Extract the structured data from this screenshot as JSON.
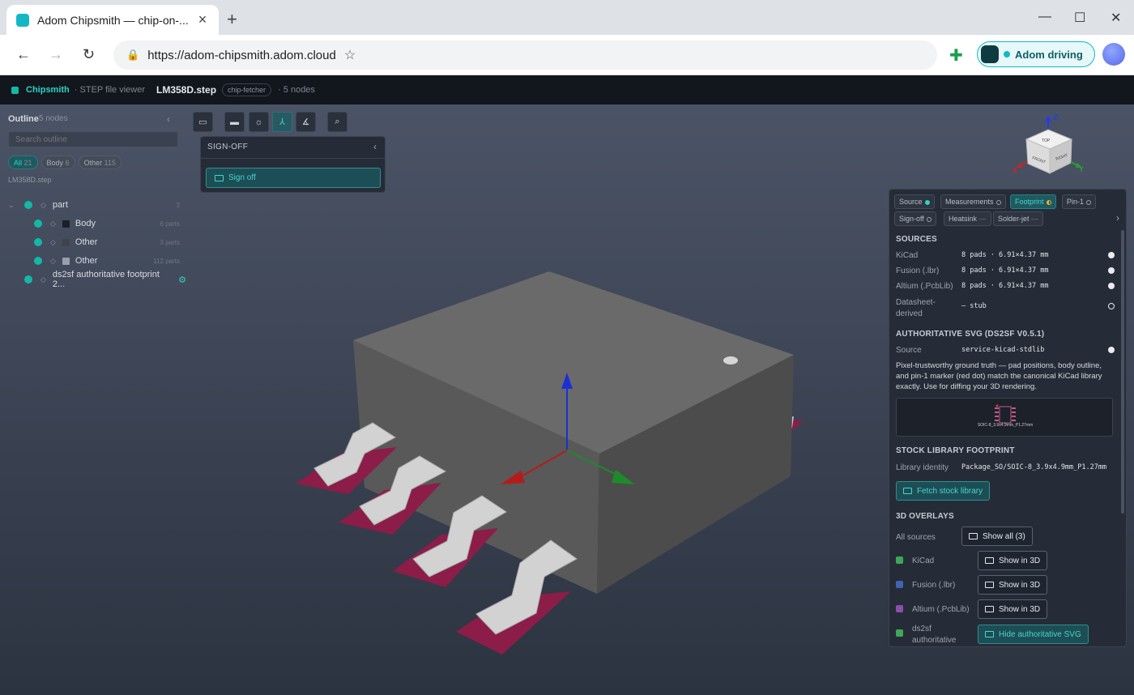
{
  "browser": {
    "tab_title": "Adom Chipsmith — chip-on-...",
    "url": "https://adom-chipsmith.adom.cloud",
    "driving_label": "Adom driving"
  },
  "appbar": {
    "brand": "Chipsmith",
    "section": "· STEP file viewer",
    "file": "LM358D.step",
    "chip": "chip-fetcher",
    "nodes": "· 5 nodes"
  },
  "outline": {
    "title": "Outline",
    "count": "5 nodes",
    "search_placeholder": "Search outline",
    "filters": [
      {
        "label": "All",
        "count": "21"
      },
      {
        "label": "Body",
        "count": "6"
      },
      {
        "label": "Other",
        "count": "115"
      }
    ],
    "file": "LM358D.step",
    "tree": [
      {
        "label": "part",
        "count": "3"
      },
      {
        "label": "Body",
        "count": "6 parts",
        "swatch": "#1c1f24"
      },
      {
        "label": "Other",
        "count": "3 parts",
        "swatch": "#3f444c"
      },
      {
        "label": "Other",
        "count": "112 parts",
        "swatch": "#9aa0a8"
      },
      {
        "label": "ds2sf authoritative footprint 2...",
        "count": ""
      }
    ]
  },
  "toolbar_icons": [
    "chip-icon",
    "ruler-icon",
    "light-icon",
    "axes-icon",
    "measure-icon",
    "zoom-icon"
  ],
  "signoff": {
    "title": "SIGN-OFF",
    "button": "Sign off"
  },
  "viewcube": {
    "faces": [
      "TOP",
      "FRONT",
      "RIGHT"
    ],
    "axes": [
      "Z",
      "X",
      "Y"
    ]
  },
  "panel": {
    "tabs": [
      {
        "label": "Source",
        "status": "filled"
      },
      {
        "label": "Measurements",
        "status": "empty"
      },
      {
        "label": "Footprint",
        "status": "half"
      },
      {
        "label": "Pin-1",
        "status": "empty"
      },
      {
        "label": "Sign-off",
        "status": "empty"
      },
      {
        "label": "Heatsink",
        "status": "—"
      },
      {
        "label": "Solder-jet",
        "status": "—"
      }
    ],
    "sources_title": "SOURCES",
    "sources": [
      {
        "label": "KiCad",
        "value": "8 pads · 6.91×4.37 mm",
        "state": "filled"
      },
      {
        "label": "Fusion (.lbr)",
        "value": "8 pads · 6.91×4.37 mm",
        "state": "filled"
      },
      {
        "label": "Altium (.PcbLib)",
        "value": "8 pads · 6.91×4.37 mm",
        "state": "filled"
      },
      {
        "label": "Datasheet-derived",
        "value": "— stub",
        "state": "empty"
      }
    ],
    "auth_title": "AUTHORITATIVE SVG (DS2SF V0.5.1)",
    "auth_source_label": "Source",
    "auth_source_value": "service-kicad-stdlib",
    "auth_desc": "Pixel-trustworthy ground truth — pad positions, body outline, and pin-1 marker (red dot) match the canonical KiCad library exactly. Use for diffing your 3D rendering.",
    "svg_caption": "SOIC-8_3.9x4.9mm_P1.27mm",
    "stock_title": "STOCK LIBRARY FOOTPRINT",
    "library_identity_label": "Library identity",
    "library_identity_value": "Package_SO/SOIC-8_3.9x4.9mm_P1.27mm",
    "fetch_button": "Fetch stock library",
    "overlays_title": "3D OVERLAYS",
    "all_sources_label": "All sources",
    "show_all_button": "Show all (3)",
    "overlays": [
      {
        "label": "KiCad",
        "color": "#3fa65a",
        "button": "Show in 3D"
      },
      {
        "label": "Fusion (.lbr)",
        "color": "#3f64b5",
        "button": "Show in 3D"
      },
      {
        "label": "Altium (.PcbLib)",
        "color": "#8a4fa8",
        "button": "Show in 3D"
      },
      {
        "label": "ds2sf authoritative",
        "color": "#3fa65a",
        "button": "Hide authoritative SVG"
      }
    ]
  }
}
